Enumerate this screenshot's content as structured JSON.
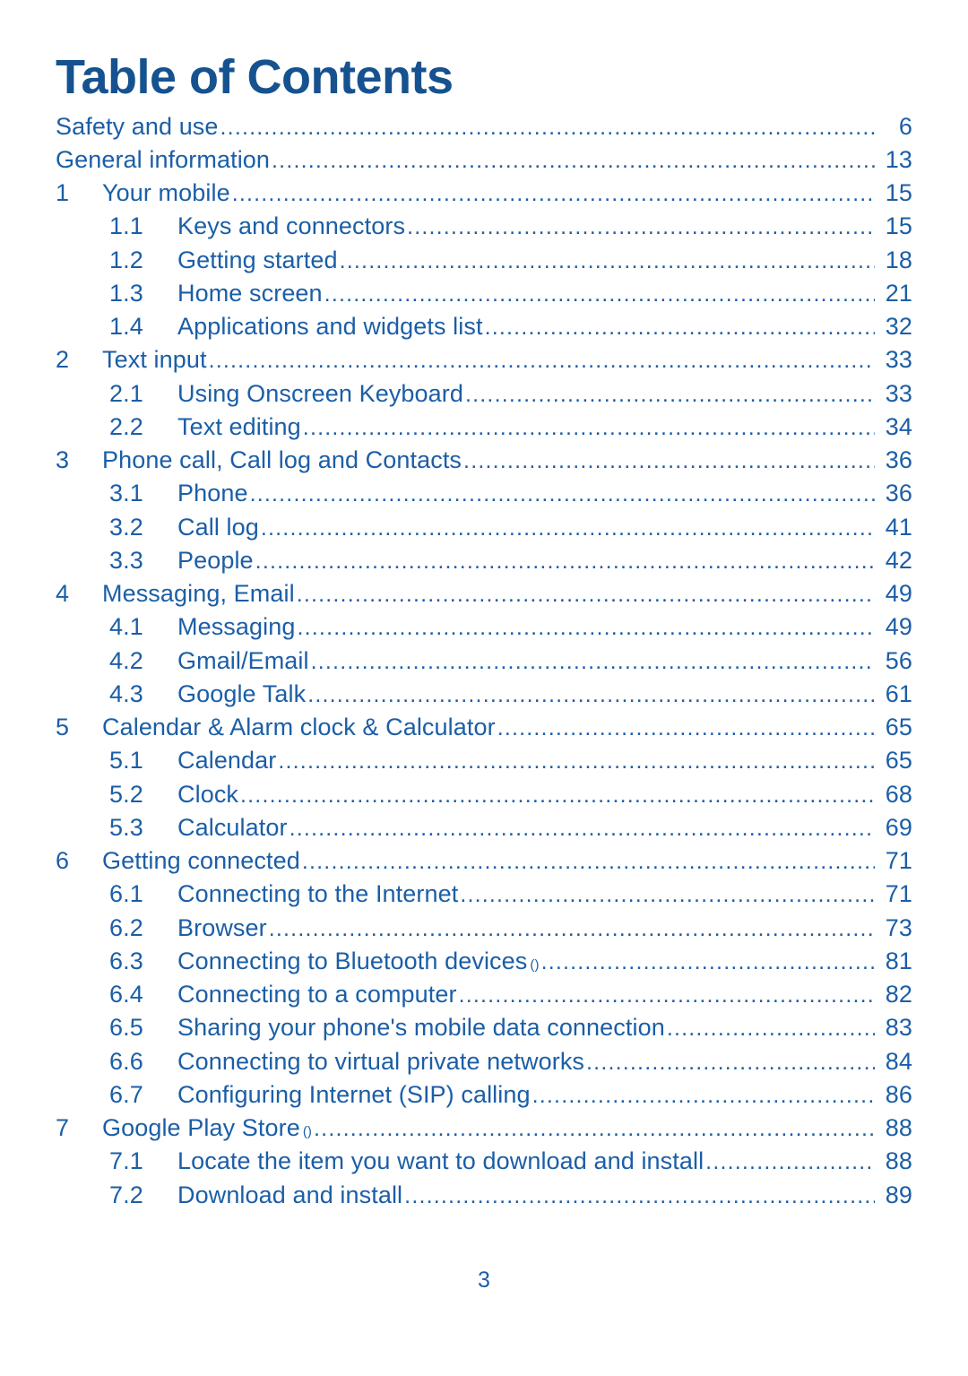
{
  "document": {
    "title": "Table of Contents",
    "page_number": "3"
  },
  "toc": {
    "entries": [
      {
        "level": 0,
        "num": "",
        "label": "Safety and use",
        "sup": "",
        "page": "6"
      },
      {
        "level": 0,
        "num": "",
        "label": "General information",
        "sup": "",
        "page": "13"
      },
      {
        "level": 1,
        "num": "1",
        "label": "Your mobile",
        "sup": "",
        "page": "15"
      },
      {
        "level": 2,
        "num": "1.1",
        "label": "Keys and connectors",
        "sup": "",
        "page": "15"
      },
      {
        "level": 2,
        "num": "1.2",
        "label": "Getting started",
        "sup": "",
        "page": "18"
      },
      {
        "level": 2,
        "num": "1.3",
        "label": "Home screen",
        "sup": "",
        "page": "21"
      },
      {
        "level": 2,
        "num": "1.4",
        "label": "Applications and widgets list",
        "sup": "",
        "page": "32"
      },
      {
        "level": 1,
        "num": "2",
        "label": "Text input",
        "sup": "",
        "page": "33"
      },
      {
        "level": 2,
        "num": "2.1",
        "label": "Using Onscreen Keyboard",
        "sup": "",
        "page": "33"
      },
      {
        "level": 2,
        "num": "2.2",
        "label": "Text editing",
        "sup": "",
        "page": "34"
      },
      {
        "level": 1,
        "num": "3",
        "label": "Phone call, Call log and Contacts",
        "sup": "",
        "page": "36"
      },
      {
        "level": 2,
        "num": "3.1",
        "label": "Phone",
        "sup": "",
        "page": "36"
      },
      {
        "level": 2,
        "num": "3.2",
        "label": "Call log",
        "sup": "",
        "page": "41"
      },
      {
        "level": 2,
        "num": "3.3",
        "label": "People",
        "sup": "",
        "page": "42"
      },
      {
        "level": 1,
        "num": "4",
        "label": "Messaging, Email",
        "sup": "",
        "page": "49"
      },
      {
        "level": 2,
        "num": "4.1",
        "label": "Messaging",
        "sup": "",
        "page": "49"
      },
      {
        "level": 2,
        "num": "4.2",
        "label": "Gmail/Email",
        "sup": "",
        "page": "56"
      },
      {
        "level": 2,
        "num": "4.3",
        "label": "Google Talk",
        "sup": "",
        "page": "61"
      },
      {
        "level": 1,
        "num": "5",
        "label": "Calendar & Alarm clock & Calculator",
        "sup": "",
        "page": "65"
      },
      {
        "level": 2,
        "num": "5.1",
        "label": "Calendar",
        "sup": "",
        "page": "65"
      },
      {
        "level": 2,
        "num": "5.2",
        "label": "Clock",
        "sup": "",
        "page": "68"
      },
      {
        "level": 2,
        "num": "5.3",
        "label": "Calculator",
        "sup": "",
        "page": "69"
      },
      {
        "level": 1,
        "num": "6",
        "label": "Getting connected",
        "sup": "",
        "page": "71"
      },
      {
        "level": 2,
        "num": "6.1",
        "label": "Connecting to the Internet",
        "sup": "",
        "page": "71"
      },
      {
        "level": 2,
        "num": "6.2",
        "label": "Browser",
        "sup": "",
        "page": "73"
      },
      {
        "level": 2,
        "num": "6.3",
        "label": "Connecting to Bluetooth devices",
        "sup": "()",
        "page": "81"
      },
      {
        "level": 2,
        "num": "6.4",
        "label": "Connecting to a computer",
        "sup": "",
        "page": "82"
      },
      {
        "level": 2,
        "num": "6.5",
        "label": "Sharing your phone's mobile data connection",
        "sup": "",
        "page": "83"
      },
      {
        "level": 2,
        "num": "6.6",
        "label": "Connecting to virtual private networks",
        "sup": "",
        "page": "84"
      },
      {
        "level": 2,
        "num": "6.7",
        "label": "Configuring Internet (SIP) calling",
        "sup": "",
        "page": "86"
      },
      {
        "level": 1,
        "num": "7",
        "label": "Google Play Store",
        "sup": "()",
        "page": "88"
      },
      {
        "level": 2,
        "num": "7.1",
        "label": "Locate the item you want to download and install",
        "sup": "",
        "page": "88"
      },
      {
        "level": 2,
        "num": "7.2",
        "label": "Download and install",
        "sup": "",
        "page": "89"
      }
    ]
  }
}
